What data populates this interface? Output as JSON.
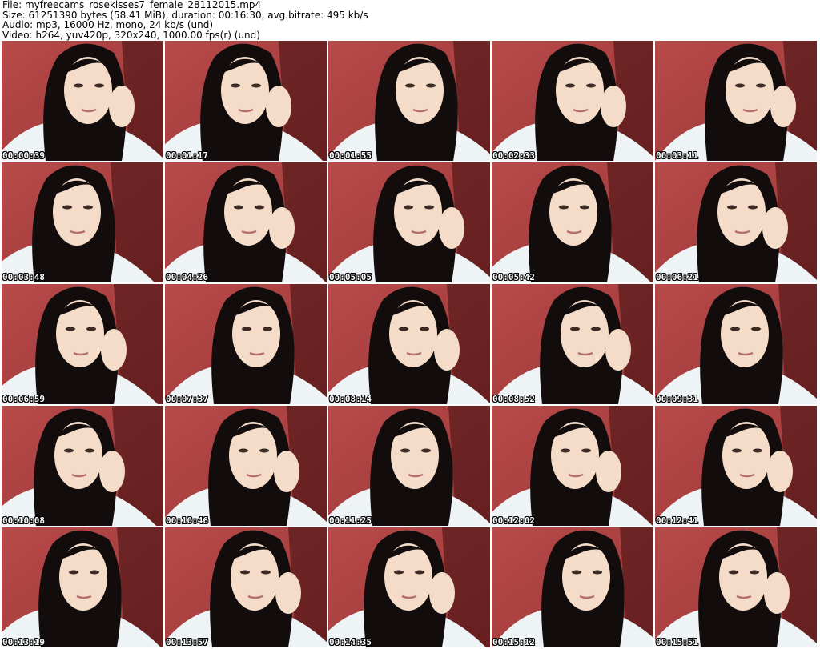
{
  "header": {
    "file": "File: myfreecams_rosekisses7_female_28112015.mp4",
    "size": "Size: 61251390 bytes (58.41 MiB), duration: 00:16:30, avg.bitrate: 495 kb/s",
    "audio": "Audio: mp3, 16000 Hz, mono, 24 kb/s (und)",
    "video": "Video: h264, yuv420p, 320x240, 1000.00 fps(r) (und)"
  },
  "colors": {
    "wall": "#b84a4a",
    "wall_dark": "#9c3636",
    "hair": "#120c0c",
    "skin": "#f4dcc8",
    "shirt": "#eef3f5"
  },
  "thumbnails": [
    {
      "time": "00:00:39"
    },
    {
      "time": "00:01:17"
    },
    {
      "time": "00:01:55"
    },
    {
      "time": "00:02:33"
    },
    {
      "time": "00:03:11"
    },
    {
      "time": "00:03:48"
    },
    {
      "time": "00:04:26"
    },
    {
      "time": "00:05:05"
    },
    {
      "time": "00:05:42"
    },
    {
      "time": "00:06:21"
    },
    {
      "time": "00:06:59"
    },
    {
      "time": "00:07:37"
    },
    {
      "time": "00:08:14"
    },
    {
      "time": "00:08:52"
    },
    {
      "time": "00:09:31"
    },
    {
      "time": "00:10:08"
    },
    {
      "time": "00:10:46"
    },
    {
      "time": "00:11:25"
    },
    {
      "time": "00:12:02"
    },
    {
      "time": "00:12:41"
    },
    {
      "time": "00:13:19"
    },
    {
      "time": "00:13:57"
    },
    {
      "time": "00:14:35"
    },
    {
      "time": "00:15:12"
    },
    {
      "time": "00:15:51"
    }
  ]
}
